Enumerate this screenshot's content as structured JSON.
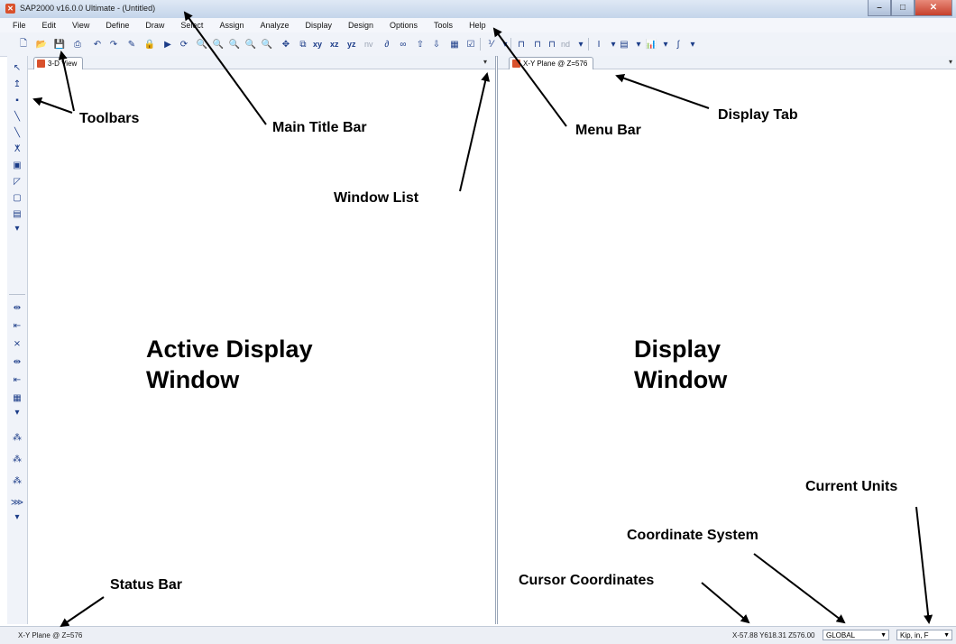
{
  "window": {
    "title": "SAP2000 v16.0.0 Ultimate  - (Untitled)",
    "app_icon": "sap2000-logo-icon",
    "controls": [
      "minimize-icon",
      "maximize-icon",
      "close-icon"
    ]
  },
  "menu": {
    "items": [
      "File",
      "Edit",
      "View",
      "Define",
      "Draw",
      "Select",
      "Assign",
      "Analyze",
      "Display",
      "Design",
      "Options",
      "Tools",
      "Help"
    ]
  },
  "toolbar": {
    "text_buttons": {
      "xy": "xy",
      "xz": "xz",
      "yz": "yz",
      "nv": "nv",
      "nd": "nd"
    }
  },
  "panels": {
    "left": {
      "tab_label": "3-D View"
    },
    "right": {
      "tab_label": "X-Y Plane @ Z=576"
    }
  },
  "statusbar": {
    "text": "X-Y Plane @ Z=576",
    "coordinates": "X-57.88  Y618.31  Z576.00",
    "coord_system": "GLOBAL",
    "units": "Kip, in, F"
  },
  "annotations": {
    "toolbars": "Toolbars",
    "main_title_bar": "Main Title Bar",
    "menu_bar": "Menu Bar",
    "display_tab": "Display Tab",
    "window_list": "Window List",
    "active_display_window_line1": "Active Display",
    "active_display_window_line2": "Window",
    "display_window_line1": "Display",
    "display_window_line2": "Window",
    "current_units": "Current Units",
    "coordinate_system": "Coordinate System",
    "cursor_coordinates": "Cursor Coordinates",
    "status_bar": "Status Bar"
  },
  "colors": {
    "app_icon": "#d9512c",
    "toolbar_icon": "#1b3c88",
    "close_button": "#c6402c"
  }
}
